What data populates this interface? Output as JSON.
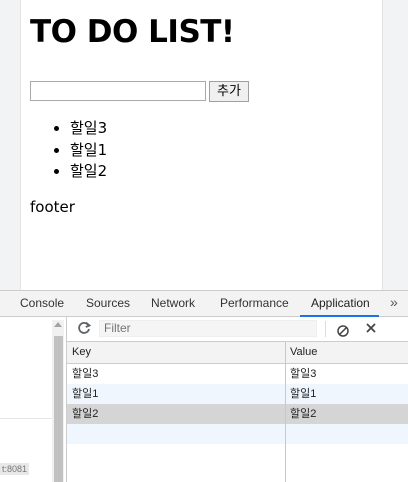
{
  "page": {
    "heading": "TO DO LIST!",
    "input_value": "",
    "add_button_label": "추가",
    "todos": [
      "할일3",
      "할일1",
      "할일2"
    ],
    "footer": "footer"
  },
  "devtools": {
    "tabs": [
      {
        "label": "Console",
        "active": false
      },
      {
        "label": "Sources",
        "active": false
      },
      {
        "label": "Network",
        "active": false
      },
      {
        "label": "Performance",
        "active": false
      },
      {
        "label": "Application",
        "active": true
      }
    ],
    "more_tabs_glyph": "»",
    "filter_placeholder": "Filter",
    "url_fragment": "t:8081",
    "columns": {
      "key": "Key",
      "value": "Value"
    },
    "rows": [
      {
        "key": "할일3",
        "value": "할일3",
        "selected": false
      },
      {
        "key": "할일1",
        "value": "할일1",
        "selected": false
      },
      {
        "key": "할일2",
        "value": "할일2",
        "selected": true
      }
    ],
    "icons": {
      "refresh": "refresh-icon",
      "clear_all": "clear-all-icon",
      "delete": "delete-icon",
      "more_tabs": "chevron-double-right-icon"
    },
    "colors": {
      "active_tab_underline": "#1a73e8",
      "selected_row": "#d5d5d5",
      "alt_row": "#f0f6fe"
    }
  }
}
